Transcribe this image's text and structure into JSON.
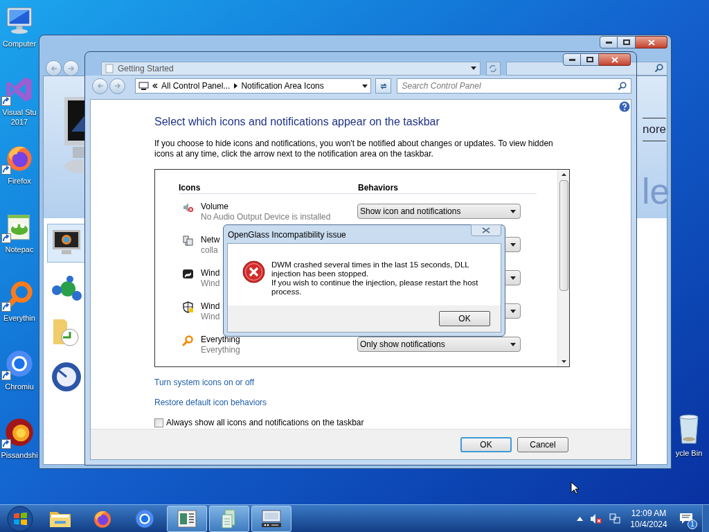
{
  "desktop_icons": [
    {
      "kind": "computer",
      "lines": [
        "Computer"
      ],
      "shortcut": false
    },
    {
      "kind": "vs",
      "lines": [
        "Visual Stu",
        "2017"
      ],
      "shortcut": true
    },
    {
      "kind": "firefox",
      "lines": [
        "Firefox"
      ],
      "shortcut": true
    },
    {
      "kind": "notepad",
      "lines": [
        "Notepac"
      ],
      "shortcut": true
    },
    {
      "kind": "everything",
      "lines": [
        "Everythin"
      ],
      "shortcut": true
    },
    {
      "kind": "chromium",
      "lines": [
        "Chromiu"
      ],
      "shortcut": true
    },
    {
      "kind": "pissandshi",
      "lines": [
        "Pissandshi"
      ],
      "shortcut": true
    }
  ],
  "recycle_bin": {
    "label": "ycle Bin"
  },
  "back_window": {
    "address": "Getting Started",
    "fragments": [
      "nore",
      "le"
    ]
  },
  "window": {
    "breadcrumbs": [
      "All Control Panel...",
      "Notification Area Icons"
    ],
    "search": {
      "placeholder": "Search Control Panel"
    },
    "heading": "Select which icons and notifications appear on the taskbar",
    "description": "If you choose to hide icons and notifications, you won't be notified about changes or updates. To view hidden icons at any time, click the arrow next to the notification area on the taskbar.",
    "table": {
      "columns": [
        "Icons",
        "Behaviors"
      ],
      "rows": [
        {
          "kind": "volume",
          "name": "Volume",
          "detail": "No Audio Output Device is installed",
          "behavior": "Show icon and notifications"
        },
        {
          "kind": "network",
          "name": "Netw",
          "detail": "colla"
        },
        {
          "kind": "flag",
          "name": "Wind",
          "detail": "Wind"
        },
        {
          "kind": "shield",
          "name": "Wind",
          "detail": "Wind"
        },
        {
          "kind": "everything",
          "name": "Everything",
          "detail": "Everything",
          "behavior": "Only show notifications"
        }
      ]
    },
    "links": [
      "Turn system icons on or off",
      "Restore default icon behaviors"
    ],
    "checkbox": {
      "label": "Always show all icons and notifications on the taskbar",
      "checked": false
    },
    "buttons": [
      {
        "label": "OK",
        "default": true
      },
      {
        "label": "Cancel",
        "default": false
      }
    ]
  },
  "dialog": {
    "title": "OpenGlass Incompatibility issue",
    "message": [
      "DWM crashed several times in the last 15 seconds, DLL injection has been stopped.",
      "If you wish to continue the injection, please restart the host process."
    ],
    "button": "OK"
  },
  "taskbar": {
    "items": [
      {
        "kind": "explorer",
        "running": false
      },
      {
        "kind": "firefox",
        "running": false
      },
      {
        "kind": "chromium",
        "running": false
      },
      {
        "kind": "panel",
        "running": true
      },
      {
        "kind": "document",
        "running": true
      },
      {
        "kind": "device",
        "running": true
      }
    ],
    "clock": {
      "time": "12:09 AM",
      "date": "10/4/2024"
    },
    "notification_count": "1"
  }
}
